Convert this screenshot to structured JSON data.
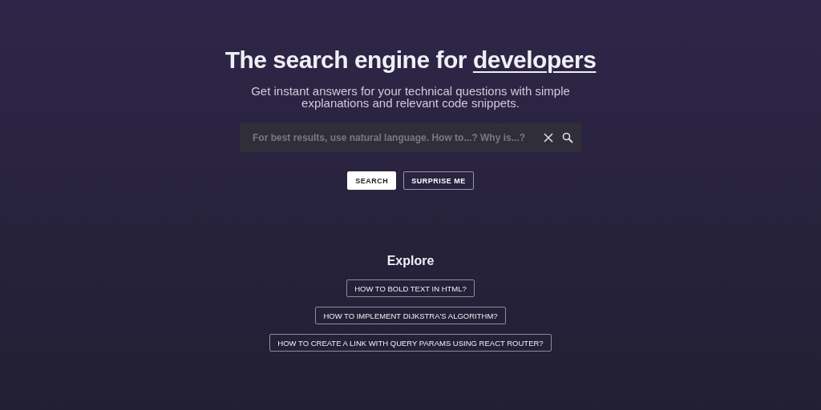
{
  "hero": {
    "title": "The search engine for",
    "title_link": "developers",
    "subtitle": "Get instant answers for your technical questions with simple explanations and relevant code snippets."
  },
  "search": {
    "placeholder": "For best results, use natural language. How to...? Why is...?"
  },
  "buttons": [
    {
      "label": "SEARCH",
      "kind": "primary"
    },
    {
      "label": "SURPRISE ME",
      "kind": "outline"
    }
  ],
  "explore": {
    "heading": "Explore",
    "items": [
      "HOW TO BOLD TEXT IN HTML?",
      "HOW TO IMPLEMENT DIJKSTRA'S ALGORITHM?",
      "HOW TO CREATE A LINK WITH QUERY PARAMS USING REACT ROUTER?"
    ]
  }
}
